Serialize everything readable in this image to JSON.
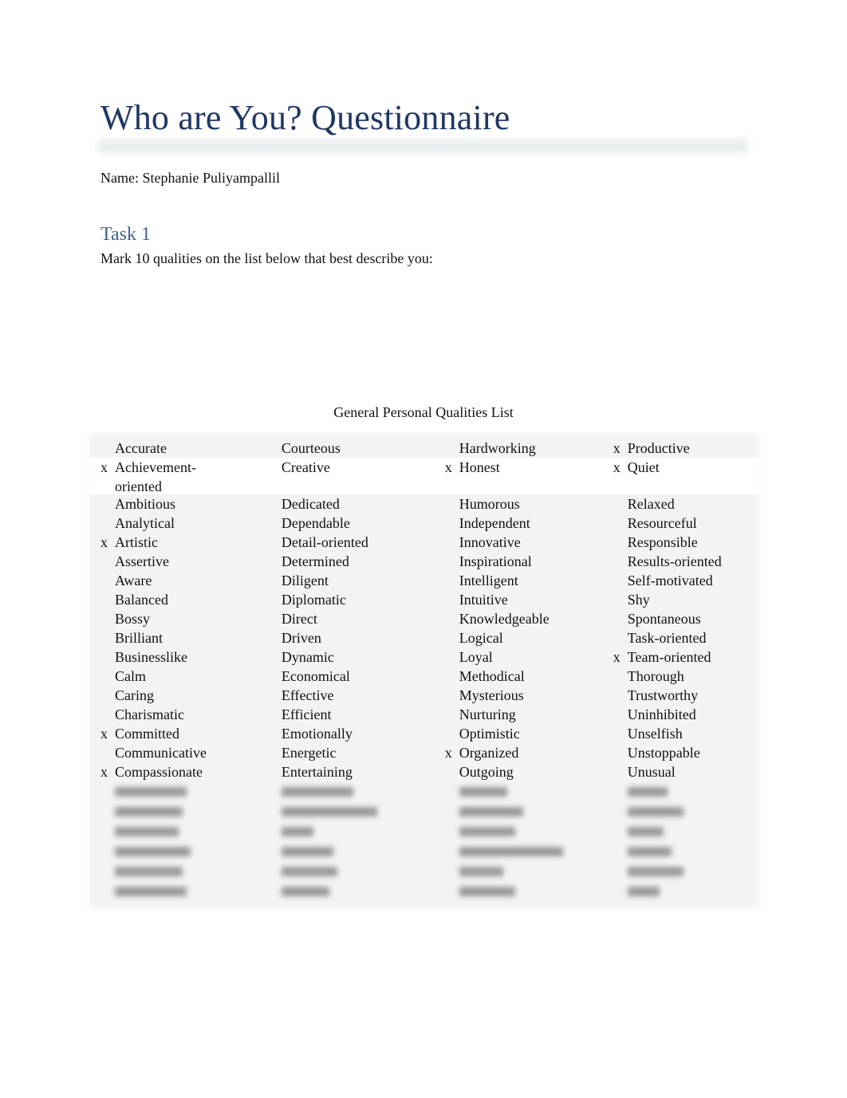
{
  "document": {
    "title": "Who are You? Questionnaire",
    "name_line": "Name: Stephanie Puliyampallil",
    "task_heading": "Task 1",
    "instruction": "Mark 10 qualities on the list below that best describe you:",
    "table_caption": "General Personal Qualities List"
  },
  "colors": {
    "title": "#1f3864",
    "task_heading": "#3f6492",
    "table_shading": "#f3f3f3"
  },
  "qualities_table": {
    "rows": [
      [
        {
          "mark": "",
          "word": "Accurate"
        },
        {
          "mark": "",
          "word": "Courteous"
        },
        {
          "mark": "",
          "word": "Hardworking"
        },
        {
          "mark": "x",
          "word": "Productive"
        }
      ],
      [
        {
          "mark": "x",
          "word": "Achievement-oriented"
        },
        {
          "mark": "",
          "word": "Creative"
        },
        {
          "mark": "x",
          "word": "Honest"
        },
        {
          "mark": "x",
          "word": "Quiet"
        }
      ],
      [
        {
          "mark": "",
          "word": "Ambitious"
        },
        {
          "mark": "",
          "word": "Dedicated"
        },
        {
          "mark": "",
          "word": "Humorous"
        },
        {
          "mark": "",
          "word": "Relaxed"
        }
      ],
      [
        {
          "mark": "",
          "word": "Analytical"
        },
        {
          "mark": "",
          "word": "Dependable"
        },
        {
          "mark": "",
          "word": "Independent"
        },
        {
          "mark": "",
          "word": "Resourceful"
        }
      ],
      [
        {
          "mark": "x",
          "word": "Artistic"
        },
        {
          "mark": "",
          "word": "Detail-oriented"
        },
        {
          "mark": "",
          "word": "Innovative"
        },
        {
          "mark": "",
          "word": "Responsible"
        }
      ],
      [
        {
          "mark": "",
          "word": "Assertive"
        },
        {
          "mark": "",
          "word": "Determined"
        },
        {
          "mark": "",
          "word": "Inspirational"
        },
        {
          "mark": "",
          "word": "Results-oriented"
        }
      ],
      [
        {
          "mark": "",
          "word": "Aware"
        },
        {
          "mark": "",
          "word": "Diligent"
        },
        {
          "mark": "",
          "word": "Intelligent"
        },
        {
          "mark": "",
          "word": "Self-motivated"
        }
      ],
      [
        {
          "mark": "",
          "word": "Balanced"
        },
        {
          "mark": "",
          "word": "Diplomatic"
        },
        {
          "mark": "",
          "word": "Intuitive"
        },
        {
          "mark": "",
          "word": "Shy"
        }
      ],
      [
        {
          "mark": "",
          "word": "Bossy"
        },
        {
          "mark": "",
          "word": "Direct"
        },
        {
          "mark": "",
          "word": "Knowledgeable"
        },
        {
          "mark": "",
          "word": "Spontaneous"
        }
      ],
      [
        {
          "mark": "",
          "word": "Brilliant"
        },
        {
          "mark": "",
          "word": "Driven"
        },
        {
          "mark": "",
          "word": "Logical"
        },
        {
          "mark": "",
          "word": "Task-oriented"
        }
      ],
      [
        {
          "mark": "",
          "word": "Businesslike"
        },
        {
          "mark": "",
          "word": "Dynamic"
        },
        {
          "mark": "",
          "word": "Loyal"
        },
        {
          "mark": "x",
          "word": "Team-oriented"
        }
      ],
      [
        {
          "mark": "",
          "word": "Calm"
        },
        {
          "mark": "",
          "word": "Economical"
        },
        {
          "mark": "",
          "word": "Methodical"
        },
        {
          "mark": "",
          "word": "Thorough"
        }
      ],
      [
        {
          "mark": "",
          "word": "Caring"
        },
        {
          "mark": "",
          "word": "Effective"
        },
        {
          "mark": "",
          "word": "Mysterious"
        },
        {
          "mark": "",
          "word": "Trustworthy"
        }
      ],
      [
        {
          "mark": "",
          "word": "Charismatic"
        },
        {
          "mark": "",
          "word": "Efficient"
        },
        {
          "mark": "",
          "word": "Nurturing"
        },
        {
          "mark": "",
          "word": "Uninhibited"
        }
      ],
      [
        {
          "mark": "x",
          "word": "Committed"
        },
        {
          "mark": "",
          "word": "Emotionally"
        },
        {
          "mark": "",
          "word": "Optimistic"
        },
        {
          "mark": "",
          "word": "Unselfish"
        }
      ],
      [
        {
          "mark": "",
          "word": "Communicative"
        },
        {
          "mark": "",
          "word": "Energetic"
        },
        {
          "mark": "x",
          "word": "Organized"
        },
        {
          "mark": "",
          "word": "Unstoppable"
        }
      ],
      [
        {
          "mark": "x",
          "word": "Compassionate"
        },
        {
          "mark": "",
          "word": "Entertaining"
        },
        {
          "mark": "",
          "word": "Outgoing"
        },
        {
          "mark": "",
          "word": "Unusual"
        }
      ]
    ],
    "blurred_row_count": 6
  }
}
